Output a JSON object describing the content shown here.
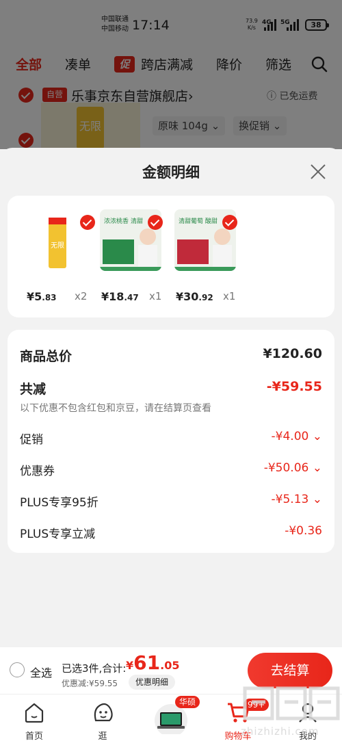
{
  "status_bar": {
    "carrier1": "中国联通",
    "carrier2": "中国移动",
    "time": "17:14",
    "net_speed": "73.9",
    "net_unit": "K/s",
    "sig1": "4G",
    "sig2": "5G",
    "battery": "38"
  },
  "tabs": [
    "全部",
    "凑单",
    "跨店满减",
    "降价",
    "筛选"
  ],
  "cu_tag": "促",
  "store": {
    "badge": "自营",
    "name": "乐事京东自营旗舰店",
    "chevron": "›",
    "shipping": "已免运费",
    "spec": "原味 104g",
    "promo": "换促销"
  },
  "sheet": {
    "title": "金额明细",
    "items": [
      {
        "price_int": "¥5",
        "price_dec": ".83",
        "qty": "x2"
      },
      {
        "price_int": "¥18",
        "price_dec": ".47",
        "qty": "x1",
        "banner": "浓浓桃香 清甜"
      },
      {
        "price_int": "¥30",
        "price_dec": ".92",
        "qty": "x1",
        "banner": "清甜葡萄 酸甜"
      }
    ],
    "total_label": "商品总价",
    "total_value": "¥120.60",
    "discount_label": "共减",
    "discount_value": "-¥59.55",
    "discount_note": "以下优惠不包含红包和京豆，请在结算页查看",
    "rows": [
      {
        "label": "促销",
        "value": "-¥4.00"
      },
      {
        "label": "优惠券",
        "value": "-¥50.06"
      },
      {
        "label": "PLUS专享95折",
        "value": "-¥5.13"
      },
      {
        "label": "PLUS专享立减",
        "value": "-¥0.36"
      }
    ]
  },
  "bottom": {
    "select_all": "全选",
    "selected": "已选3件,合计:",
    "currency": "¥",
    "total_int": "61",
    "total_dec": ".05",
    "discount": "优惠减:¥59.55",
    "detail_btn": "优惠明细",
    "checkout": "去结算"
  },
  "tabbar": {
    "items": [
      "首页",
      "逛",
      "",
      "购物车",
      "我的"
    ],
    "promo_badge": "华硕",
    "cart_badge": "99+"
  },
  "watermark": "zhizhizhi.com",
  "colors": {
    "accent": "#e8261a"
  }
}
